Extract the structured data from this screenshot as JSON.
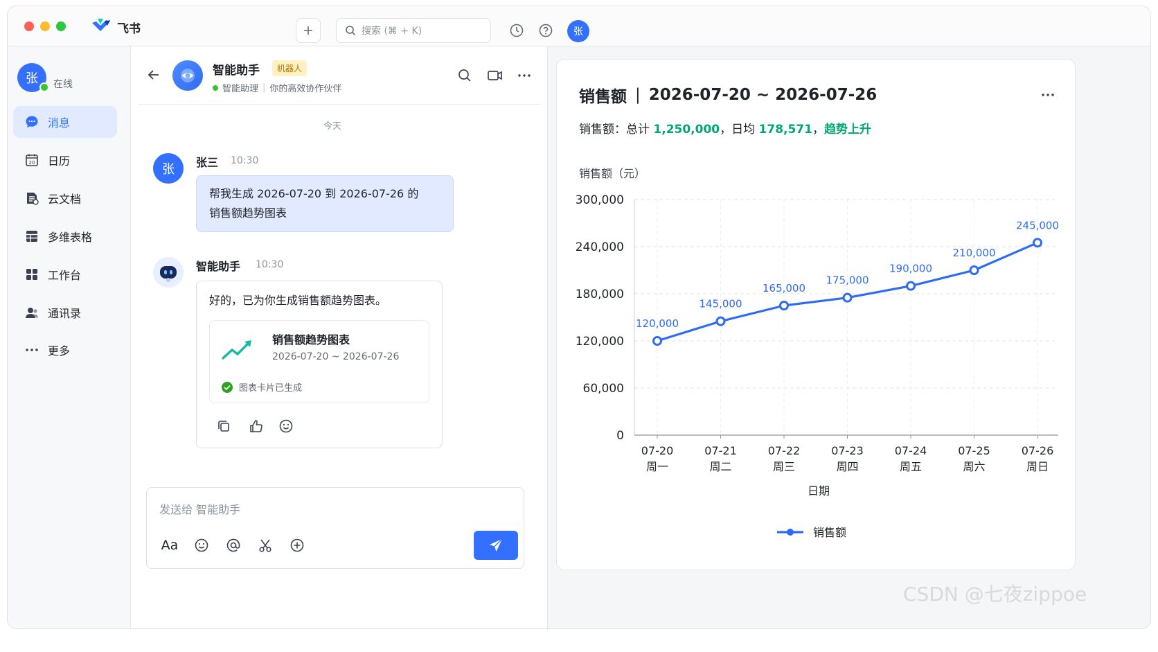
{
  "app": {
    "brand": "飞书"
  },
  "topbar": {
    "search_placeholder": "搜索 (⌘ + K)",
    "avatar_char": "张"
  },
  "sidebar": {
    "avatar_char": "张",
    "status": "在线",
    "items": [
      {
        "label": "消息",
        "icon": "chat-icon"
      },
      {
        "label": "日历",
        "icon": "calendar-icon"
      },
      {
        "label": "云文档",
        "icon": "doc-icon"
      },
      {
        "label": "多维表格",
        "icon": "table-icon"
      },
      {
        "label": "工作台",
        "icon": "grid-icon"
      },
      {
        "label": "通讯录",
        "icon": "contacts-icon"
      },
      {
        "label": "更多",
        "icon": "more-icon"
      }
    ]
  },
  "chat": {
    "name": "智能助手",
    "tag": "机器人",
    "sub_a": "智能助理",
    "sub_sep": "|",
    "sub_b": "你的高效协作伙伴",
    "date_divider": "今天",
    "user_msg": {
      "avatar_char": "张",
      "name": "张三",
      "time": "10:30",
      "line1": "帮我生成 2026-07-20 到 2026-07-26 的",
      "line2": "销售额趋势图表"
    },
    "bot_msg": {
      "name": "智能助手",
      "time": "10:30",
      "text": "好的，已为你生成销售额趋势图表。"
    },
    "card": {
      "title": "销售额趋势图表",
      "range": "2026-07-20 ~ 2026-07-26",
      "status": "图表卡片已生成"
    },
    "composer_placeholder": "发送给 智能助手",
    "composer_font_label": "Aa"
  },
  "panel": {
    "title_left": "销售额",
    "title_sep": "|",
    "title_right": "2026-07-20 ~ 2026-07-26",
    "summary_prefix": "销售额：总计",
    "summary_total": "1,250,000",
    "summary_mid": "，日均",
    "summary_avg": "178,571",
    "summary_comma": "，",
    "summary_trend": "趋势上升"
  },
  "chart_data": {
    "type": "line",
    "title": "",
    "ylabel": "销售额（元）",
    "xlabel": "日期",
    "ylim": [
      0,
      300000
    ],
    "yticks": [
      0,
      60000,
      120000,
      180000,
      240000,
      300000
    ],
    "ytick_labels": [
      "0",
      "60,000",
      "120,000",
      "180,000",
      "240,000",
      "300,000"
    ],
    "categories": [
      "07-20",
      "07-21",
      "07-22",
      "07-23",
      "07-24",
      "07-25",
      "07-26"
    ],
    "category_sub": [
      "周一",
      "周二",
      "周三",
      "周四",
      "周五",
      "周六",
      "周日"
    ],
    "series": [
      {
        "name": "销售额",
        "color": "#2f6bf2",
        "values": [
          120000,
          145000,
          165000,
          175000,
          190000,
          210000,
          245000
        ],
        "labels": [
          "120,000",
          "145,000",
          "165,000",
          "175,000",
          "190,000",
          "210,000",
          "245,000"
        ]
      }
    ],
    "grid": true,
    "legend": "bottom-center"
  },
  "watermark": "CSDN @七夜zippoe"
}
